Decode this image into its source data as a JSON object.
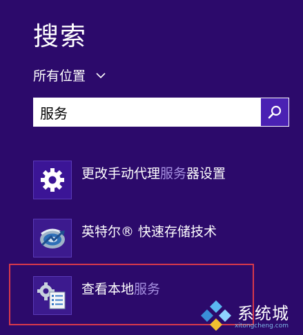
{
  "header": {
    "title": "搜索"
  },
  "scope": {
    "label": "所有位置"
  },
  "search": {
    "value": "服务",
    "placeholder": ""
  },
  "results": [
    {
      "prefix": "更改手动代理",
      "match": "服务",
      "suffix": "器设置",
      "icon": "gear-icon"
    },
    {
      "prefix": "英特尔® 快速存储技术",
      "match": "",
      "suffix": "",
      "icon": "intel-rst-icon"
    },
    {
      "prefix": "查看本地",
      "match": "服务",
      "suffix": "",
      "icon": "services-icon"
    }
  ],
  "watermark": {
    "text": "系统城",
    "url": "xitongcheng.com"
  },
  "colors": {
    "background": "#2c0a6b",
    "accent": "#4a21b3",
    "highlight": "#a58fe0",
    "selection_frame": "#d9394b"
  }
}
